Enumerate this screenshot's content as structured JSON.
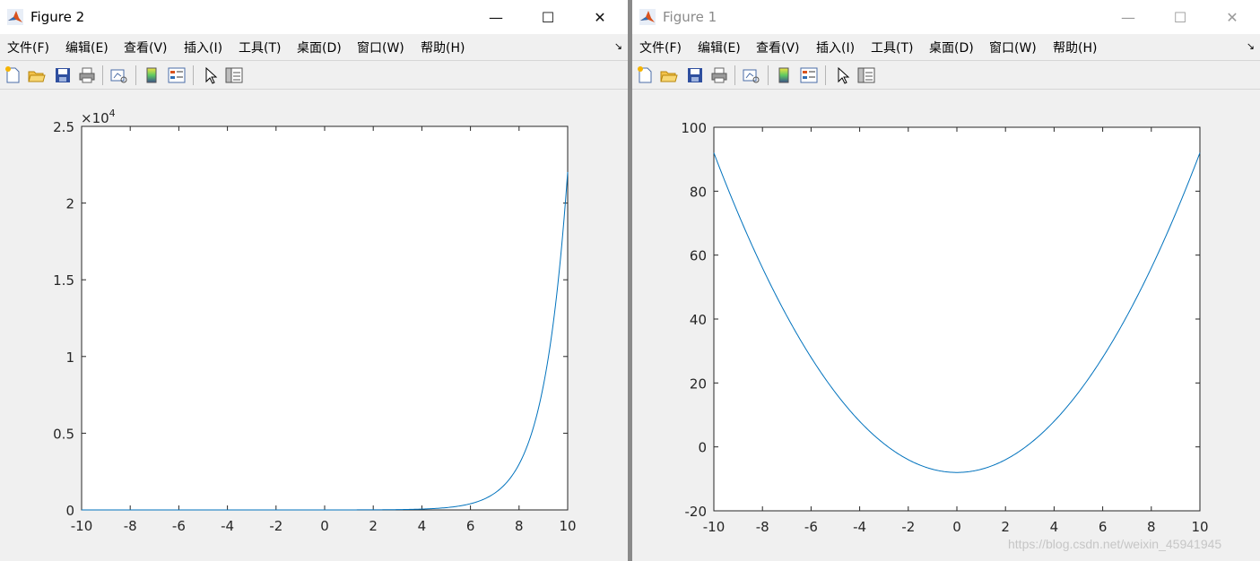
{
  "windows": [
    {
      "title": "Figure 2",
      "menu": [
        "文件(F)",
        "编辑(E)",
        "查看(V)",
        "插入(I)",
        "工具(T)",
        "桌面(D)",
        "窗口(W)",
        "帮助(H)"
      ],
      "menu_overflow_icon": "menu-arrow-icon",
      "toolbar_icons": [
        "new-figure-icon",
        "open-file-icon",
        "save-icon",
        "print-icon",
        "link-plot-icon",
        "colorbar-icon",
        "legend-icon",
        "edit-pointer-icon",
        "property-editor-icon"
      ],
      "window_controls": [
        "minimize-icon",
        "maximize-icon",
        "close-icon"
      ],
      "chart_data": {
        "type": "line",
        "function_shape": "exponential",
        "x": [
          -10,
          -8,
          -6,
          -4,
          -2,
          0,
          2,
          4,
          5,
          6,
          6.5,
          7,
          7.5,
          8,
          8.5,
          9,
          9.5,
          10
        ],
        "y": [
          0,
          0,
          0,
          0,
          0,
          1,
          7,
          55,
          148,
          403,
          665,
          1097,
          1808,
          2981,
          4915,
          8103,
          13360,
          22026
        ],
        "xlim": [
          -10,
          10
        ],
        "ylim": [
          0,
          25000
        ],
        "xticks": [
          -10,
          -8,
          -6,
          -4,
          -2,
          0,
          2,
          4,
          6,
          8,
          10
        ],
        "xtick_labels": [
          "-10",
          "-8",
          "-6",
          "-4",
          "-2",
          "0",
          "2",
          "4",
          "6",
          "8",
          "10"
        ],
        "yticks": [
          0,
          5000,
          10000,
          15000,
          20000,
          25000
        ],
        "ytick_labels": [
          "0",
          "0.5",
          "1",
          "1.5",
          "2",
          "2.5"
        ],
        "y_exponent_base": "×10",
        "y_exponent_power": "4",
        "line_color": "#0072bd",
        "grid": false
      }
    },
    {
      "title": "Figure 1",
      "menu": [
        "文件(F)",
        "编辑(E)",
        "查看(V)",
        "插入(I)",
        "工具(T)",
        "桌面(D)",
        "窗口(W)",
        "帮助(H)"
      ],
      "menu_overflow_icon": "menu-arrow-icon",
      "toolbar_icons": [
        "new-figure-icon",
        "open-file-icon",
        "save-icon",
        "print-icon",
        "link-plot-icon",
        "colorbar-icon",
        "legend-icon",
        "edit-pointer-icon",
        "property-editor-icon"
      ],
      "window_controls": [
        "minimize-icon",
        "maximize-icon",
        "close-icon"
      ],
      "chart_data": {
        "type": "line",
        "function_shape": "quadratic",
        "x": [
          -10,
          -9,
          -8,
          -7,
          -6,
          -5,
          -4,
          -3,
          -2,
          -1,
          0,
          1,
          2,
          3,
          4,
          5,
          6,
          7,
          8,
          9,
          10
        ],
        "y": [
          92,
          73,
          56,
          41,
          28,
          17,
          8,
          1,
          -4,
          -7,
          -8,
          -7,
          -4,
          1,
          8,
          17,
          28,
          41,
          56,
          73,
          92
        ],
        "xlim": [
          -10,
          10
        ],
        "ylim": [
          -20,
          100
        ],
        "xticks": [
          -10,
          -8,
          -6,
          -4,
          -2,
          0,
          2,
          4,
          6,
          8,
          10
        ],
        "xtick_labels": [
          "-10",
          "-8",
          "-6",
          "-4",
          "-2",
          "0",
          "2",
          "4",
          "6",
          "8",
          "10"
        ],
        "yticks": [
          -20,
          0,
          20,
          40,
          60,
          80,
          100
        ],
        "ytick_labels": [
          "-20",
          "0",
          "20",
          "40",
          "60",
          "80",
          "100"
        ],
        "line_color": "#0072bd",
        "grid": false
      }
    }
  ],
  "watermark": "https://blog.csdn.net/weixin_45941945"
}
